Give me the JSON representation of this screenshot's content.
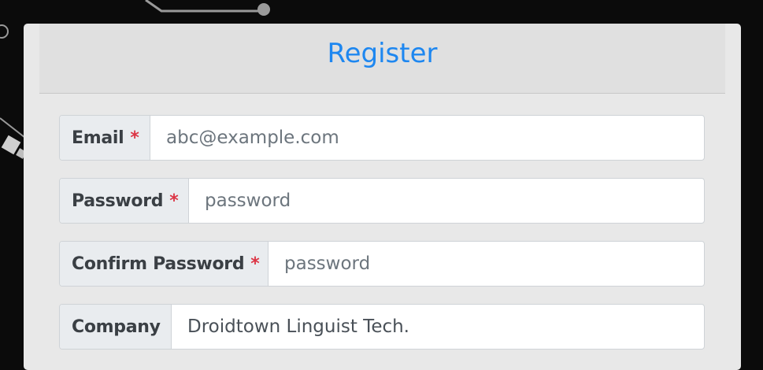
{
  "form": {
    "title": "Register",
    "required_marker": "*",
    "fields": [
      {
        "label": "Email",
        "required": true,
        "placeholder": "abc@example.com",
        "value": ""
      },
      {
        "label": "Password",
        "required": true,
        "placeholder": "password",
        "value": ""
      },
      {
        "label": "Confirm Password",
        "required": true,
        "placeholder": "password",
        "value": ""
      },
      {
        "label": "Company",
        "required": false,
        "placeholder": "",
        "value": "Droidtown Linguist Tech."
      }
    ]
  },
  "colors": {
    "title": "#1e87f0",
    "required": "#dc3545",
    "background": "#0b0b0b",
    "panel": "#e8e8e8"
  }
}
